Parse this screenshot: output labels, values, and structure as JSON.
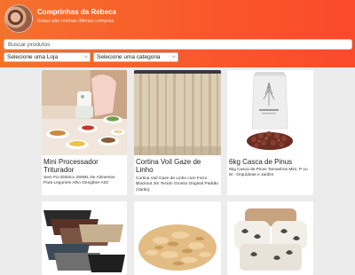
{
  "header": {
    "store_name": "Comprinhas da Rebeca",
    "subtitle": "Essas são minhas últimas compras"
  },
  "search": {
    "placeholder": "Buscar produtos"
  },
  "filters": {
    "store_select": "Selecione uma Loja",
    "category_select": "Selecione uma categoria"
  },
  "products": [
    {
      "name": "Mini Processador Triturador",
      "description": "Sem Fio Elétrico 250ML De Alimentos Para Legumes Alho Gengibre-A02"
    },
    {
      "name": "Cortina Voil Gaze de Linho",
      "description": "Cortina Voil Gaze de Linho com Forro Blackout 3m Tecido Grosso Original Padrão (Varão)"
    },
    {
      "name": "6kg Casca de Pinus",
      "description": "6kg Casca de Pinus Tamanhos Mini, P ou M - Orquídeas e Jardim"
    },
    {
      "name": "",
      "description": ""
    },
    {
      "name": "",
      "description": ""
    },
    {
      "name": "",
      "description": ""
    }
  ]
}
